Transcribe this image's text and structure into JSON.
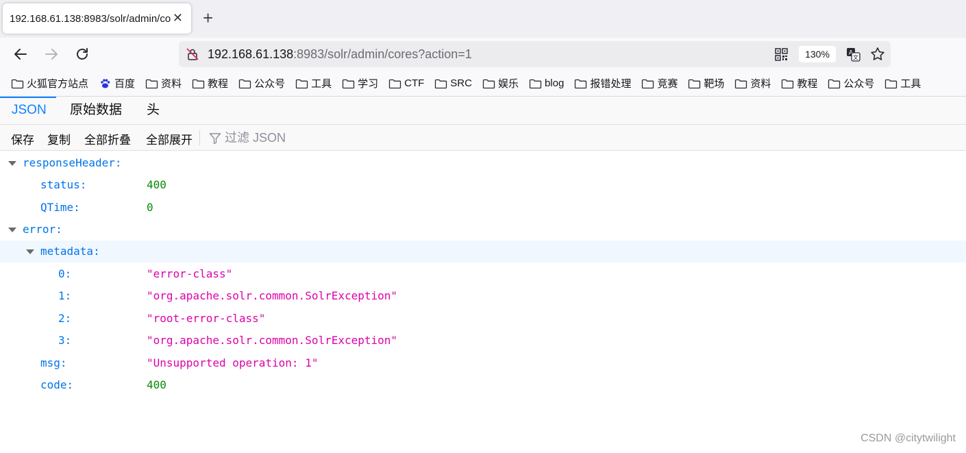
{
  "browser": {
    "tab": {
      "title": "192.168.61.138:8983/solr/admin/cores?action=1"
    },
    "url": {
      "host": "192.168.61.138",
      "rest": ":8983/solr/admin/cores?action=1"
    },
    "zoom": "130%",
    "bookmarks": [
      "火狐官方站点",
      "百度",
      "资料",
      "教程",
      "公众号",
      "工具",
      "学习",
      "CTF",
      "SRC",
      "娱乐",
      "blog",
      "报错处理",
      "竞赛",
      "靶场",
      "资料",
      "教程",
      "公众号",
      "工具"
    ]
  },
  "viewer": {
    "tabs": [
      "JSON",
      "原始数据",
      "头"
    ],
    "active_tab": "JSON",
    "toolbar": {
      "save": "保存",
      "copy": "复制",
      "collapse_all": "全部折叠",
      "expand_all": "全部展开",
      "filter_placeholder": "过滤 JSON"
    }
  },
  "json": {
    "responseHeader": {
      "key": "responseHeader:",
      "status_key": "status:",
      "status": "400",
      "qtime_key": "QTime:",
      "qtime": "0"
    },
    "error": {
      "key": "error:",
      "metadata_key": "metadata:",
      "metadata": [
        {
          "key": "0:",
          "value": "\"error-class\""
        },
        {
          "key": "1:",
          "value": "\"org.apache.solr.common.SolrException\""
        },
        {
          "key": "2:",
          "value": "\"root-error-class\""
        },
        {
          "key": "3:",
          "value": "\"org.apache.solr.common.SolrException\""
        }
      ],
      "msg_key": "msg:",
      "msg": "\"Unsupported operation: 1\"",
      "code_key": "code:",
      "code": "400"
    }
  },
  "watermark": "CSDN @citytwilight",
  "colors": {
    "key": "#0074e8",
    "number": "#058b00",
    "string": "#dd00a9",
    "accent": "#0a84ff"
  }
}
